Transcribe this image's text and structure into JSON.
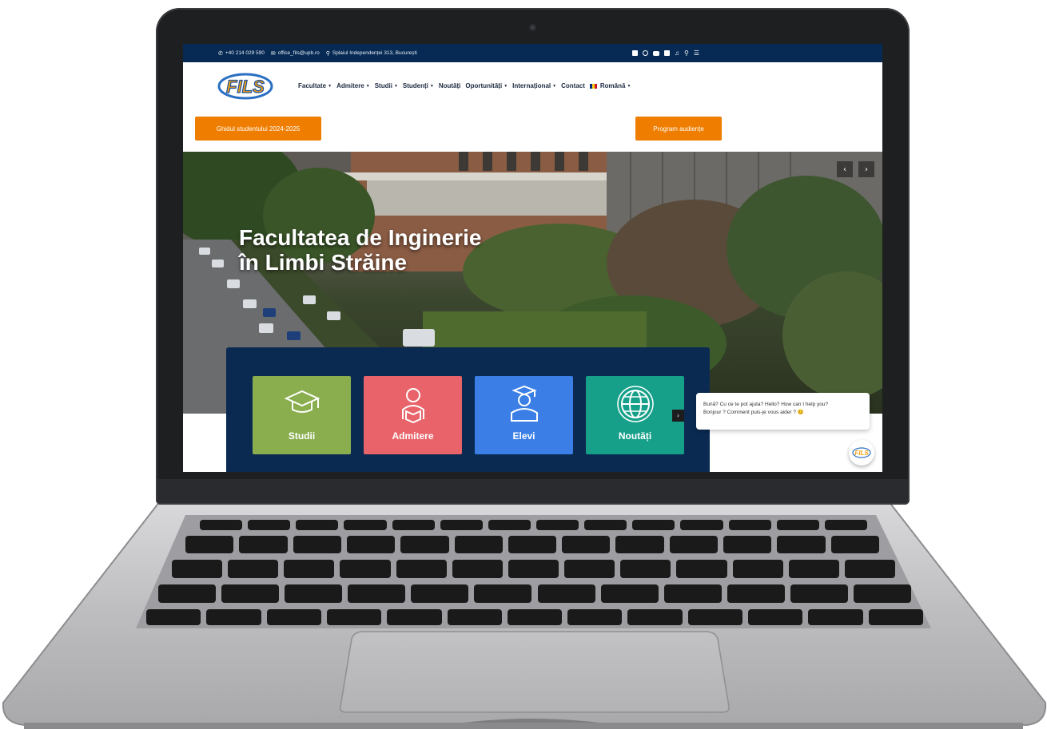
{
  "topbar": {
    "phone": "+40 214 029 590",
    "email": "office_fils@upb.ro",
    "address": "Splaiul Independenței 313, București",
    "icons": [
      "facebook-icon",
      "instagram-icon",
      "youtube-icon",
      "linkedin-icon",
      "tiktok-icon",
      "search-icon",
      "menu-icon"
    ]
  },
  "header": {
    "logo_text": "FILS",
    "nav": [
      "Facultate",
      "Admitere",
      "Studii",
      "Studenți",
      "Noutăți",
      "Oportunități",
      "Internațional",
      "Contact",
      "Română"
    ],
    "language_flag": "ro-flag"
  },
  "buttons": {
    "guide": "Ghidul studentului 2024-2025",
    "audience": "Program audiențe"
  },
  "hero": {
    "title_line1": "Facultatea de Inginerie",
    "title_line2": "în Limbi Străine"
  },
  "quick_links": [
    {
      "label": "Studii",
      "icon": "graduation-cap-icon",
      "color": "#8aae4e"
    },
    {
      "label": "Admitere",
      "icon": "student-book-icon",
      "color": "#e8646a"
    },
    {
      "label": "Elevi",
      "icon": "graduate-icon",
      "color": "#3b7fe6"
    },
    {
      "label": "Noutăți",
      "icon": "globe-icon",
      "color": "#16a08a"
    }
  ],
  "chat": {
    "line1": "Bună? Cu ce te pot ajuta? Hello? How can I help you?",
    "line2": "Bonjour ? Comment puis-je vous aider ? 😊"
  },
  "colors": {
    "topbar": "#062a54",
    "accent_orange": "#ef7d00",
    "panel": "#0b2a52"
  }
}
